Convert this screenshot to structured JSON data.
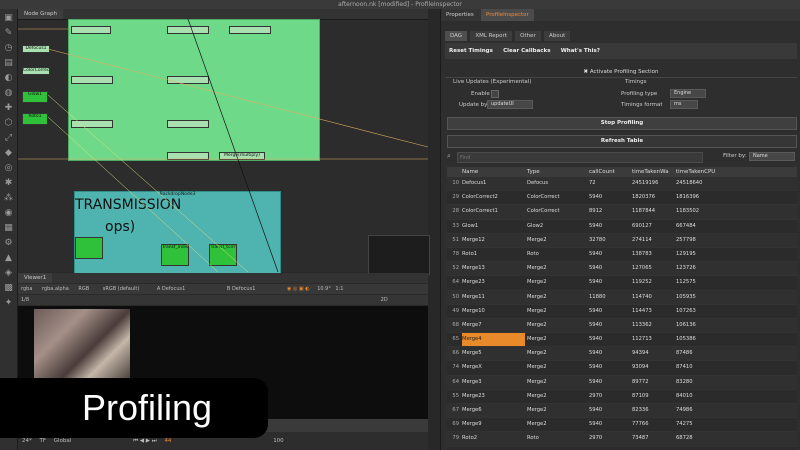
{
  "window": {
    "title": "afternoon.nk [modified] - ProfileInspector"
  },
  "node_graph": {
    "tab_label": "Node Graph",
    "backdrop_transmission": {
      "title": "TRANSMISSION",
      "subtitle": "ops)",
      "label": "BackdropNode3"
    },
    "nodes": [
      {
        "label": "Defocus1",
        "color": "#a8e0b0"
      },
      {
        "label": "ColorCorrect2",
        "color": "#a8e0b0"
      },
      {
        "label": "Glow1",
        "color": "#2fc13a"
      },
      {
        "label": "Roto1",
        "color": "#2fc13a"
      },
      {
        "label": "Merge12",
        "color": "#a8e0b0"
      },
      {
        "label": "Transf_indiv",
        "color": "#2fc13a"
      },
      {
        "label": "Transf_tcirr",
        "color": "#2fc13a"
      },
      {
        "label": "Merge(multiply)",
        "color": "#a8e0b0"
      }
    ]
  },
  "viewer": {
    "tab_label": "Viewer1",
    "channels": "rgba",
    "alpha": "rgba.alpha",
    "colorspace": "RGB",
    "lut": "sRGB (default)",
    "input_a": "A Defocus1",
    "input_b": "B Defocus1",
    "zoom": "10.9°",
    "ratio": "1:1",
    "mode": "2D",
    "frame": "1/8",
    "fps": "24*",
    "tf": "TF",
    "scope": "Global",
    "current_frame": "44",
    "end_frame": "100"
  },
  "overlay": {
    "caption": "Profiling"
  },
  "properties": {
    "tabs": [
      {
        "label": "Properties",
        "active": false
      },
      {
        "label": "ProfileInspector",
        "active": true
      }
    ],
    "sub_tabs": [
      {
        "label": "DAG",
        "active": true
      },
      {
        "label": "XML Report",
        "active": false
      },
      {
        "label": "Other",
        "active": false
      },
      {
        "label": "About",
        "active": false
      }
    ],
    "buttons": {
      "reset_timings": "Reset Timings",
      "clear_callbacks": "Clear Callbacks",
      "whats_this": "What's This?",
      "stop_profiling": "Stop Profiling",
      "refresh_table": "Refresh Table"
    },
    "activate_section": "✖ Activate Profiling Section",
    "live_updates_label": "Live Updates (Experimental)",
    "timings_label": "Timings",
    "enable_label": "Enable",
    "update_by_label": "Update by:",
    "update_by_value": "updateUI",
    "profiling_type_label": "Profiling type",
    "profiling_type_value": "Engine",
    "timings_format_label": "Timings format",
    "timings_format_value": "ms",
    "search_placeholder": "Find",
    "filter_label": "Filter by:",
    "filter_value": "Name",
    "table": {
      "columns": [
        "",
        "Name",
        "Type",
        "callCount",
        "timeTakenWa",
        "timeTakenCPU"
      ],
      "rows": [
        [
          "10",
          "Defocus1",
          "Defocus",
          "72",
          "24519196",
          "24518640"
        ],
        [
          "29",
          "ColorCorrect2",
          "ColorCorrect",
          "5940",
          "1820376",
          "1816396"
        ],
        [
          "28",
          "ColorCorrect1",
          "ColorCorrect",
          "8912",
          "1187844",
          "1183502"
        ],
        [
          "33",
          "Glow1",
          "Glow2",
          "5940",
          "690127",
          "667484"
        ],
        [
          "51",
          "Merge12",
          "Merge2",
          "32780",
          "274114",
          "257798"
        ],
        [
          "78",
          "Roto1",
          "Roto",
          "5940",
          "138783",
          "129195"
        ],
        [
          "52",
          "Merge13",
          "Merge2",
          "5940",
          "127065",
          "123726"
        ],
        [
          "64",
          "Merge23",
          "Merge2",
          "5940",
          "119252",
          "112575"
        ],
        [
          "50",
          "Merge11",
          "Merge2",
          "11880",
          "114740",
          "105935"
        ],
        [
          "49",
          "Merge10",
          "Merge2",
          "5940",
          "114473",
          "107263"
        ],
        [
          "68",
          "Merge7",
          "Merge2",
          "5940",
          "113362",
          "106136"
        ],
        [
          "65",
          "Merge4",
          "Merge2",
          "5940",
          "112713",
          "105386"
        ],
        [
          "66",
          "Merge5",
          "Merge2",
          "5940",
          "94394",
          "87486"
        ],
        [
          "74",
          "MergeX",
          "Merge2",
          "5940",
          "93094",
          "87410"
        ],
        [
          "64",
          "Merge3",
          "Merge2",
          "5940",
          "89772",
          "83280"
        ],
        [
          "55",
          "Merge23",
          "Merge2",
          "2970",
          "87109",
          "84010"
        ],
        [
          "67",
          "Merge6",
          "Merge2",
          "5940",
          "82336",
          "74986"
        ],
        [
          "69",
          "Merge9",
          "Merge2",
          "5940",
          "77766",
          "74275"
        ],
        [
          "79",
          "Roto2",
          "Roto",
          "2970",
          "73487",
          "68728"
        ]
      ],
      "highlight_row_index": 11,
      "highlight_color": "#e88a2a"
    }
  }
}
